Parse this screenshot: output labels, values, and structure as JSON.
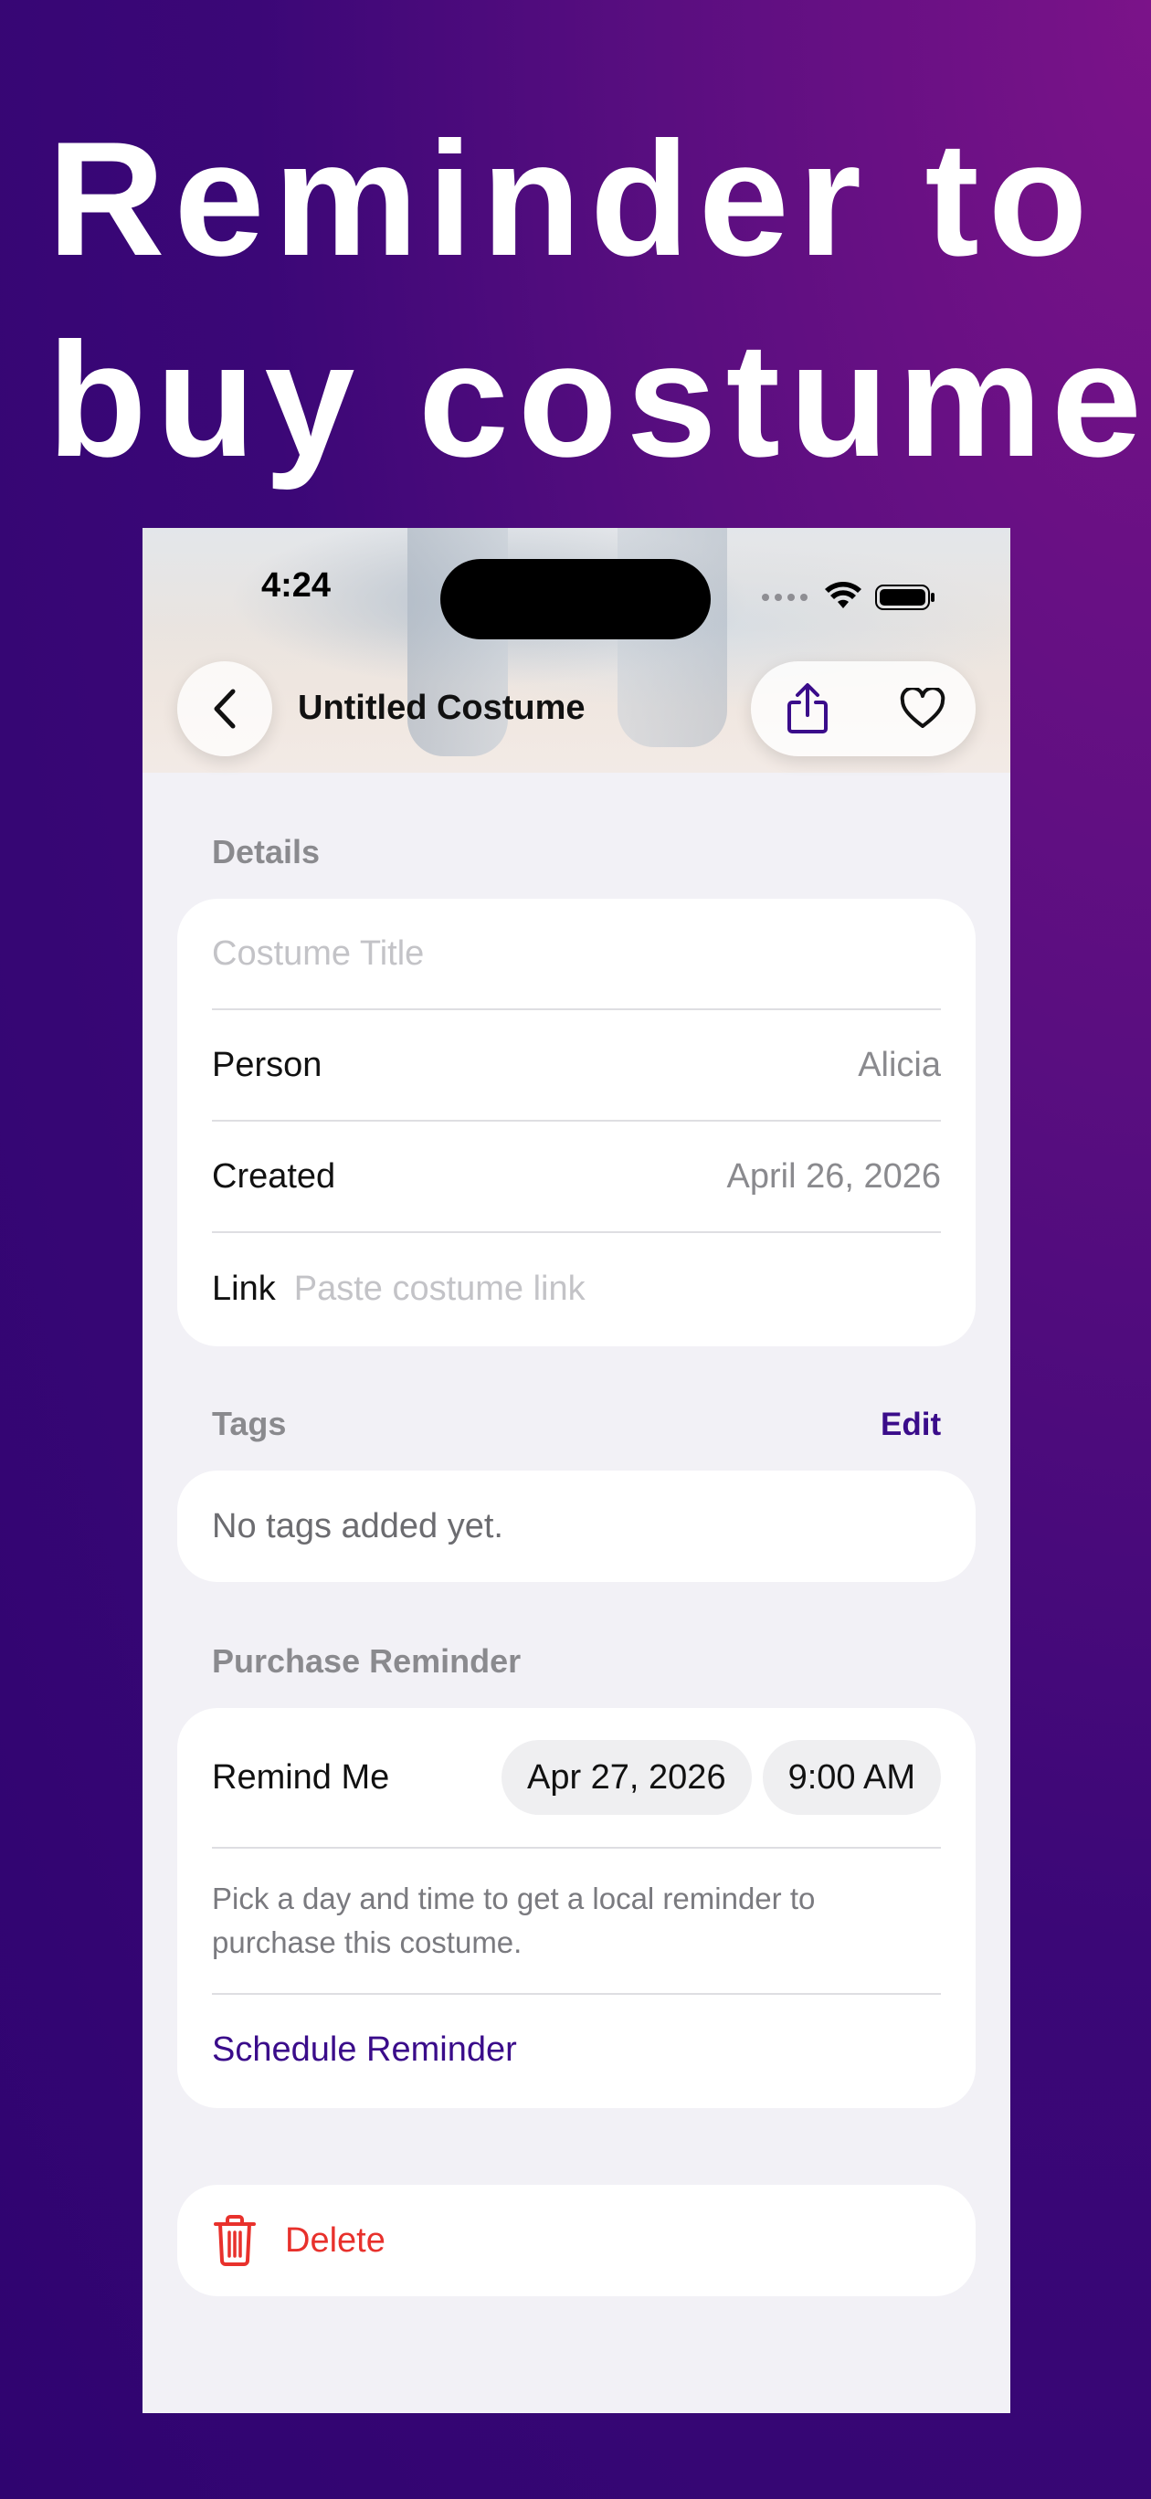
{
  "headline": {
    "line1": "Reminder to",
    "line2": "buy costume"
  },
  "status_bar": {
    "time": "4:24"
  },
  "nav": {
    "title": "Untitled Costume"
  },
  "details": {
    "section_label": "Details",
    "title_placeholder": "Costume Title",
    "person_label": "Person",
    "person_value": "Alicia",
    "created_label": "Created",
    "created_value": "April 26, 2026",
    "link_label": "Link",
    "link_placeholder": "Paste costume link"
  },
  "tags": {
    "section_label": "Tags",
    "edit_label": "Edit",
    "empty_text": "No tags added yet."
  },
  "reminder": {
    "section_label": "Purchase Reminder",
    "remind_label": "Remind Me",
    "date_value": "Apr 27, 2026",
    "time_value": "9:00 AM",
    "helper_text": "Pick a day and time to get a local reminder to purchase this costume.",
    "schedule_label": "Schedule Reminder"
  },
  "delete": {
    "label": "Delete"
  },
  "colors": {
    "accent": "#3a0c8a",
    "destructive": "#e8312c",
    "background_top": "#7b1389",
    "background_bottom": "#2f0470"
  }
}
